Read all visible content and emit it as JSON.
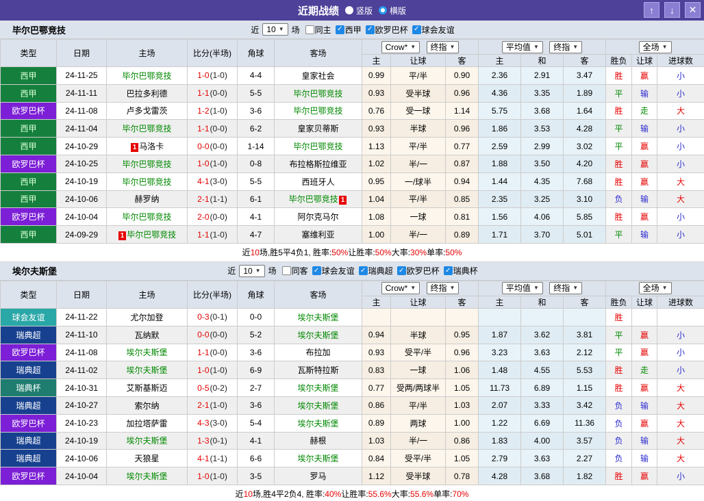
{
  "titlebar": {
    "title": "近期战绩",
    "radios": [
      {
        "label": "竖版",
        "selected": false
      },
      {
        "label": "横版",
        "selected": true
      }
    ]
  },
  "icons": {
    "up": "↑",
    "down": "↓",
    "close": "✕",
    "caret": "▼",
    "check": "✓",
    "red_card": "1"
  },
  "colors": {
    "accent": "#4d4199",
    "win_red": "#e60000",
    "draw_green": "#008800",
    "lose_blue": "#2b2bd0"
  },
  "table_header": {
    "cols": [
      "类型",
      "日期",
      "主场",
      "比分(半场)",
      "角球",
      "客场"
    ],
    "dropdown_groups": [
      [
        "Crow*",
        "终指"
      ],
      [
        "平均值",
        "终指"
      ],
      [
        "全场"
      ]
    ],
    "sub_cols": [
      "主",
      "让球",
      "客",
      "主",
      "和",
      "客",
      "胜负",
      "让球",
      "进球数"
    ]
  },
  "league_colors": {
    "西甲": {
      "bg": "#15803d",
      "fg": "#d9ffd9"
    },
    "欧罗巴杯": {
      "bg": "#7c1fd6",
      "fg": "#ffffff"
    },
    "球会友谊": {
      "bg": "#2aa7a7",
      "fg": "#ffffff"
    },
    "瑞典超": {
      "bg": "#17418f",
      "fg": "#ffffff"
    },
    "瑞典杯": {
      "bg": "#1e7d6f",
      "fg": "#ffffff"
    }
  },
  "sections": [
    {
      "team": "毕尔巴鄂竞技",
      "filter": {
        "near_label": "近",
        "count": "10",
        "games_label": "场",
        "same": {
          "label": "同主",
          "checked": false
        },
        "leagues": [
          {
            "label": "西甲",
            "checked": true
          },
          {
            "label": "欧罗巴杯",
            "checked": true
          },
          {
            "label": "球会友谊",
            "checked": true
          }
        ]
      },
      "rows": [
        {
          "league": "西甲",
          "date": "24-11-25",
          "home": {
            "name": "毕尔巴鄂竞技",
            "green": true
          },
          "score": "1-0",
          "half": "(1-0)",
          "corner": "4-4",
          "away": {
            "name": "皇家社会"
          },
          "handicap": [
            "0.99",
            "平/半",
            "0.90"
          ],
          "avg": [
            "2.36",
            "2.91",
            "3.47"
          ],
          "result": [
            [
              "胜",
              "r"
            ],
            [
              "赢",
              "r"
            ],
            [
              "小",
              "b"
            ]
          ]
        },
        {
          "league": "西甲",
          "date": "24-11-11",
          "home": {
            "name": "巴拉多利德"
          },
          "score": "1-1",
          "half": "(0-0)",
          "corner": "5-5",
          "away": {
            "name": "毕尔巴鄂竞技",
            "green": true
          },
          "handicap": [
            "0.93",
            "受半球",
            "0.96"
          ],
          "avg": [
            "4.36",
            "3.35",
            "1.89"
          ],
          "result": [
            [
              "平",
              "g"
            ],
            [
              "输",
              "b"
            ],
            [
              "小",
              "b"
            ]
          ]
        },
        {
          "league": "欧罗巴杯",
          "date": "24-11-08",
          "home": {
            "name": "卢多戈雷茨"
          },
          "score": "1-2",
          "half": "(1-0)",
          "corner": "3-6",
          "away": {
            "name": "毕尔巴鄂竞技",
            "green": true
          },
          "handicap": [
            "0.76",
            "受一球",
            "1.14"
          ],
          "avg": [
            "5.75",
            "3.68",
            "1.64"
          ],
          "result": [
            [
              "胜",
              "r"
            ],
            [
              "走",
              "g"
            ],
            [
              "大",
              "r"
            ]
          ]
        },
        {
          "league": "西甲",
          "date": "24-11-04",
          "home": {
            "name": "毕尔巴鄂竞技",
            "green": true
          },
          "score": "1-1",
          "half": "(0-0)",
          "corner": "6-2",
          "away": {
            "name": "皇家贝蒂斯"
          },
          "handicap": [
            "0.93",
            "半球",
            "0.96"
          ],
          "avg": [
            "1.86",
            "3.53",
            "4.28"
          ],
          "result": [
            [
              "平",
              "g"
            ],
            [
              "输",
              "b"
            ],
            [
              "小",
              "b"
            ]
          ]
        },
        {
          "league": "西甲",
          "date": "24-10-29",
          "home": {
            "name": "马洛卡",
            "card": "before"
          },
          "score": "0-0",
          "half": "(0-0)",
          "corner": "1-14",
          "away": {
            "name": "毕尔巴鄂竞技",
            "green": true
          },
          "handicap": [
            "1.13",
            "平/半",
            "0.77"
          ],
          "avg": [
            "2.59",
            "2.99",
            "3.02"
          ],
          "result": [
            [
              "平",
              "g"
            ],
            [
              "赢",
              "r"
            ],
            [
              "小",
              "b"
            ]
          ]
        },
        {
          "league": "欧罗巴杯",
          "date": "24-10-25",
          "home": {
            "name": "毕尔巴鄂竞技",
            "green": true
          },
          "score": "1-0",
          "half": "(1-0)",
          "corner": "0-8",
          "away": {
            "name": "布拉格斯拉维亚"
          },
          "handicap": [
            "1.02",
            "半/一",
            "0.87"
          ],
          "avg": [
            "1.88",
            "3.50",
            "4.20"
          ],
          "result": [
            [
              "胜",
              "r"
            ],
            [
              "赢",
              "r"
            ],
            [
              "小",
              "b"
            ]
          ]
        },
        {
          "league": "西甲",
          "date": "24-10-19",
          "home": {
            "name": "毕尔巴鄂竞技",
            "green": true
          },
          "score": "4-1",
          "half": "(3-0)",
          "corner": "5-5",
          "away": {
            "name": "西班牙人"
          },
          "handicap": [
            "0.95",
            "一/球半",
            "0.94"
          ],
          "avg": [
            "1.44",
            "4.35",
            "7.68"
          ],
          "result": [
            [
              "胜",
              "r"
            ],
            [
              "赢",
              "r"
            ],
            [
              "大",
              "r"
            ]
          ]
        },
        {
          "league": "西甲",
          "date": "24-10-06",
          "home": {
            "name": "赫罗纳"
          },
          "score": "2-1",
          "half": "(1-1)",
          "corner": "6-1",
          "away": {
            "name": "毕尔巴鄂竞技",
            "green": true,
            "card": "after"
          },
          "handicap": [
            "1.04",
            "平/半",
            "0.85"
          ],
          "avg": [
            "2.35",
            "3.25",
            "3.10"
          ],
          "result": [
            [
              "负",
              "b"
            ],
            [
              "输",
              "b"
            ],
            [
              "大",
              "r"
            ]
          ]
        },
        {
          "league": "欧罗巴杯",
          "date": "24-10-04",
          "home": {
            "name": "毕尔巴鄂竞技",
            "green": true
          },
          "score": "2-0",
          "half": "(0-0)",
          "corner": "4-1",
          "away": {
            "name": "阿尔克马尔"
          },
          "handicap": [
            "1.08",
            "一球",
            "0.81"
          ],
          "avg": [
            "1.56",
            "4.06",
            "5.85"
          ],
          "result": [
            [
              "胜",
              "r"
            ],
            [
              "赢",
              "r"
            ],
            [
              "小",
              "b"
            ]
          ]
        },
        {
          "league": "西甲",
          "date": "24-09-29",
          "home": {
            "name": "毕尔巴鄂竞技",
            "green": true,
            "card": "before"
          },
          "score": "1-1",
          "half": "(1-0)",
          "corner": "4-7",
          "away": {
            "name": "塞维利亚"
          },
          "handicap": [
            "1.00",
            "半/一",
            "0.89"
          ],
          "avg": [
            "1.71",
            "3.70",
            "5.01"
          ],
          "result": [
            [
              "平",
              "g"
            ],
            [
              "输",
              "b"
            ],
            [
              "小",
              "b"
            ]
          ]
        }
      ],
      "summary": [
        [
          "近",
          "k"
        ],
        [
          "10",
          "r"
        ],
        [
          "场,胜5平4负1, 胜率:",
          "k"
        ],
        [
          "50%",
          "r"
        ],
        [
          " 让胜率:",
          "k"
        ],
        [
          "50%",
          "r"
        ],
        [
          " 大率:",
          "k"
        ],
        [
          "30%",
          "r"
        ],
        [
          " 单率:",
          "k"
        ],
        [
          "50%",
          "r"
        ]
      ]
    },
    {
      "team": "埃尔夫斯堡",
      "filter": {
        "near_label": "近",
        "count": "10",
        "games_label": "场",
        "same": {
          "label": "同客",
          "checked": false
        },
        "leagues": [
          {
            "label": "球会友谊",
            "checked": true
          },
          {
            "label": "瑞典超",
            "checked": true
          },
          {
            "label": "欧罗巴杯",
            "checked": true
          },
          {
            "label": "瑞典杯",
            "checked": true
          }
        ]
      },
      "rows": [
        {
          "league": "球会友谊",
          "date": "24-11-22",
          "home": {
            "name": "尤尔加登"
          },
          "score": "0-3",
          "half": "(0-1)",
          "corner": "0-0",
          "away": {
            "name": "埃尔夫斯堡",
            "green": true
          },
          "handicap": [
            "",
            "",
            ""
          ],
          "avg": [
            "",
            "",
            ""
          ],
          "result": [
            [
              "胜",
              "r"
            ],
            [
              "",
              "k"
            ],
            [
              "",
              "k"
            ]
          ]
        },
        {
          "league": "瑞典超",
          "date": "24-11-10",
          "home": {
            "name": "瓦纳默"
          },
          "score": "0-0",
          "half": "(0-0)",
          "corner": "5-2",
          "away": {
            "name": "埃尔夫斯堡",
            "green": true
          },
          "handicap": [
            "0.94",
            "半球",
            "0.95"
          ],
          "avg": [
            "1.87",
            "3.62",
            "3.81"
          ],
          "result": [
            [
              "平",
              "g"
            ],
            [
              "赢",
              "r"
            ],
            [
              "小",
              "b"
            ]
          ]
        },
        {
          "league": "欧罗巴杯",
          "date": "24-11-08",
          "home": {
            "name": "埃尔夫斯堡",
            "green": true
          },
          "score": "1-1",
          "half": "(0-0)",
          "corner": "3-6",
          "away": {
            "name": "布拉加"
          },
          "handicap": [
            "0.93",
            "受平/半",
            "0.96"
          ],
          "avg": [
            "3.23",
            "3.63",
            "2.12"
          ],
          "result": [
            [
              "平",
              "g"
            ],
            [
              "赢",
              "r"
            ],
            [
              "小",
              "b"
            ]
          ]
        },
        {
          "league": "瑞典超",
          "date": "24-11-02",
          "home": {
            "name": "埃尔夫斯堡",
            "green": true
          },
          "score": "1-0",
          "half": "(1-0)",
          "corner": "6-9",
          "away": {
            "name": "瓦斯特拉斯"
          },
          "handicap": [
            "0.83",
            "一球",
            "1.06"
          ],
          "avg": [
            "1.48",
            "4.55",
            "5.53"
          ],
          "result": [
            [
              "胜",
              "r"
            ],
            [
              "走",
              "g"
            ],
            [
              "小",
              "b"
            ]
          ]
        },
        {
          "league": "瑞典杯",
          "date": "24-10-31",
          "home": {
            "name": "艾斯基斯迈"
          },
          "score": "0-5",
          "half": "(0-2)",
          "corner": "2-7",
          "away": {
            "name": "埃尔夫斯堡",
            "green": true
          },
          "handicap": [
            "0.77",
            "受两/两球半",
            "1.05"
          ],
          "avg": [
            "11.73",
            "6.89",
            "1.15"
          ],
          "result": [
            [
              "胜",
              "r"
            ],
            [
              "赢",
              "r"
            ],
            [
              "大",
              "r"
            ]
          ]
        },
        {
          "league": "瑞典超",
          "date": "24-10-27",
          "home": {
            "name": "索尔纳"
          },
          "score": "2-1",
          "half": "(1-0)",
          "corner": "3-6",
          "away": {
            "name": "埃尔夫斯堡",
            "green": true
          },
          "handicap": [
            "0.86",
            "平/半",
            "1.03"
          ],
          "avg": [
            "2.07",
            "3.33",
            "3.42"
          ],
          "result": [
            [
              "负",
              "b"
            ],
            [
              "输",
              "b"
            ],
            [
              "大",
              "r"
            ]
          ]
        },
        {
          "league": "欧罗巴杯",
          "date": "24-10-23",
          "home": {
            "name": "加拉塔萨雷"
          },
          "score": "4-3",
          "half": "(3-0)",
          "corner": "5-4",
          "away": {
            "name": "埃尔夫斯堡",
            "green": true
          },
          "handicap": [
            "0.89",
            "两球",
            "1.00"
          ],
          "avg": [
            "1.22",
            "6.69",
            "11.36"
          ],
          "result": [
            [
              "负",
              "b"
            ],
            [
              "赢",
              "r"
            ],
            [
              "大",
              "r"
            ]
          ]
        },
        {
          "league": "瑞典超",
          "date": "24-10-19",
          "home": {
            "name": "埃尔夫斯堡",
            "green": true
          },
          "score": "1-3",
          "half": "(0-1)",
          "corner": "4-1",
          "away": {
            "name": "赫根"
          },
          "handicap": [
            "1.03",
            "半/一",
            "0.86"
          ],
          "avg": [
            "1.83",
            "4.00",
            "3.57"
          ],
          "result": [
            [
              "负",
              "b"
            ],
            [
              "输",
              "b"
            ],
            [
              "大",
              "r"
            ]
          ]
        },
        {
          "league": "瑞典超",
          "date": "24-10-06",
          "home": {
            "name": "天狼星"
          },
          "score": "4-1",
          "half": "(1-1)",
          "corner": "6-6",
          "away": {
            "name": "埃尔夫斯堡",
            "green": true
          },
          "handicap": [
            "0.84",
            "受平/半",
            "1.05"
          ],
          "avg": [
            "2.79",
            "3.63",
            "2.27"
          ],
          "result": [
            [
              "负",
              "b"
            ],
            [
              "输",
              "b"
            ],
            [
              "大",
              "r"
            ]
          ]
        },
        {
          "league": "欧罗巴杯",
          "date": "24-10-04",
          "home": {
            "name": "埃尔夫斯堡",
            "green": true
          },
          "score": "1-0",
          "half": "(1-0)",
          "corner": "3-5",
          "away": {
            "name": "罗马"
          },
          "handicap": [
            "1.12",
            "受半球",
            "0.78"
          ],
          "avg": [
            "4.28",
            "3.68",
            "1.82"
          ],
          "result": [
            [
              "胜",
              "r"
            ],
            [
              "赢",
              "r"
            ],
            [
              "小",
              "b"
            ]
          ]
        }
      ],
      "summary": [
        [
          "近",
          "k"
        ],
        [
          "10",
          "r"
        ],
        [
          "场,胜4平2负4, 胜率:",
          "k"
        ],
        [
          "40%",
          "r"
        ],
        [
          " 让胜率:",
          "k"
        ],
        [
          "55.6%",
          "r"
        ],
        [
          " 大率:",
          "k"
        ],
        [
          "55.6%",
          "r"
        ],
        [
          " 单率:",
          "k"
        ],
        [
          "70%",
          "r"
        ]
      ]
    }
  ]
}
